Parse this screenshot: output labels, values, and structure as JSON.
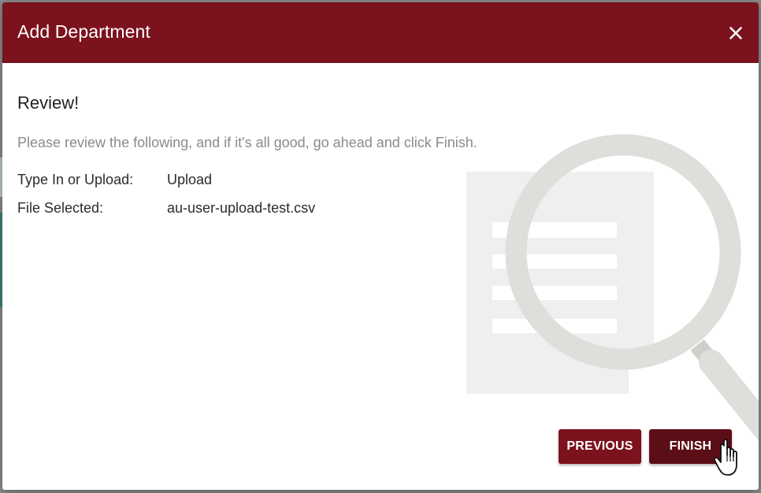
{
  "dialog": {
    "title": "Add Department",
    "close_icon": "close-icon"
  },
  "review": {
    "heading": "Review!",
    "description": "Please review the following, and if it's all good, go ahead and click Finish.",
    "rows": [
      {
        "label": "Type In or Upload:",
        "value": "Upload"
      },
      {
        "label": "File Selected:",
        "value": "au-user-upload-test.csv"
      }
    ],
    "illustration_icon": "magnifying-glass-document-icon"
  },
  "actions": {
    "previous_label": "PREVIOUS",
    "finish_label": "FINISH"
  },
  "colors": {
    "header": "#7b121d",
    "finish_button": "#5c0e16",
    "previous_button": "#7b121d"
  },
  "cursor_icon": "hand-pointer-cursor-icon"
}
